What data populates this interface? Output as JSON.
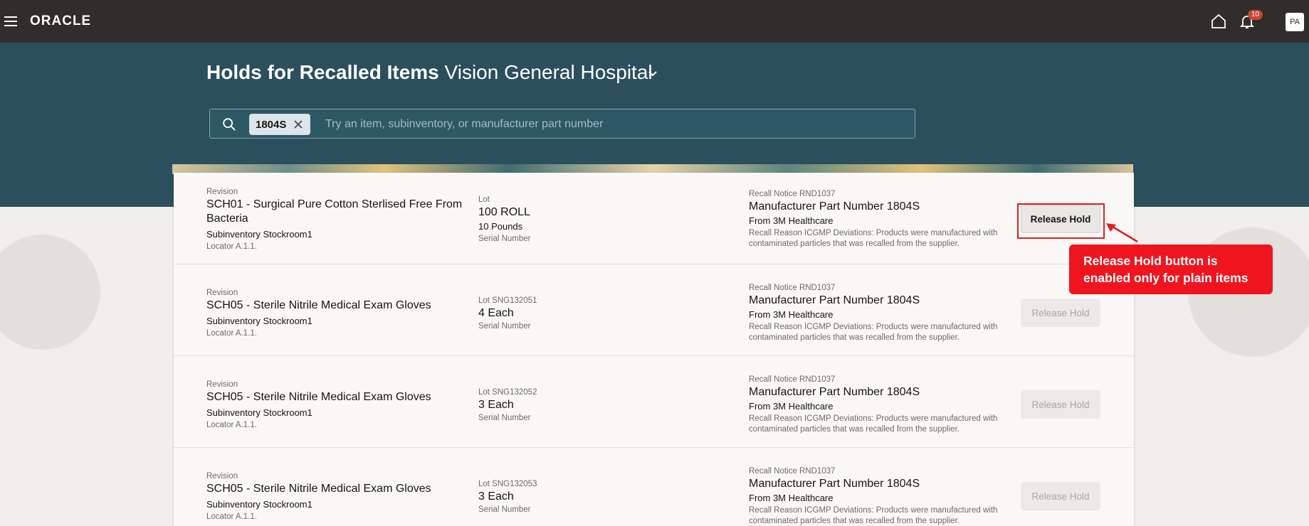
{
  "topbar": {
    "logo": "ORACLE",
    "notification_count": "10",
    "avatar_initials": "PA",
    "icons": [
      "menu-icon",
      "home-icon",
      "bell-icon"
    ]
  },
  "header": {
    "title_bold": "Holds for Recalled Items",
    "title_org": "Vision General Hospital"
  },
  "search": {
    "chip_value": "1804S",
    "placeholder": "Try an item, subinventory, or manufacturer part number"
  },
  "rows": [
    {
      "revision": "Revision",
      "item": "SCH01 - Surgical Pure Cotton Sterlised Free From Bacteria",
      "subinventory": "Subinventory Stockroom1",
      "locator": "Locator A.1.1.",
      "lot_label": "Lot",
      "quantity": "100 ROLL",
      "secondary_qty": "10 Pounds",
      "serial": "Serial Number",
      "recall_notice": "Recall Notice RND1037",
      "mpn": "Manufacturer Part Number 1804S",
      "from": "From 3M Healthcare",
      "reason_1": "Recall Reason ICGMP Deviations: Products were manufactured with",
      "reason_2": "contaminated particles that was recalled from the supplier.",
      "button": "Release Hold",
      "enabled": true
    },
    {
      "revision": "Revision",
      "item": "SCH05 - Sterile Nitrile Medical Exam Gloves",
      "subinventory": "Subinventory Stockroom1",
      "locator": "Locator A.1.1.",
      "lot_label": "Lot SNG132051",
      "quantity": "4 Each",
      "serial": "Serial Number",
      "recall_notice": "Recall Notice RND1037",
      "mpn": "Manufacturer Part Number 1804S",
      "from": "From 3M Healthcare",
      "reason_1": "Recall Reason ICGMP Deviations: Products were manufactured with",
      "reason_2": "contaminated particles that was recalled from the supplier.",
      "button": "Release Hold",
      "enabled": false
    },
    {
      "revision": "Revision",
      "item": "SCH05 - Sterile Nitrile Medical Exam Gloves",
      "subinventory": "Subinventory Stockroom1",
      "locator": "Locator A.1.1.",
      "lot_label": "Lot SNG132052",
      "quantity": "3 Each",
      "serial": "Serial Number",
      "recall_notice": "Recall Notice RND1037",
      "mpn": "Manufacturer Part Number 1804S",
      "from": "From 3M Healthcare",
      "reason_1": "Recall Reason ICGMP Deviations: Products were manufactured with",
      "reason_2": "contaminated particles that was recalled from the supplier.",
      "button": "Release Hold",
      "enabled": false
    },
    {
      "revision": "Revision",
      "item": "SCH05 - Sterile Nitrile Medical Exam Gloves",
      "subinventory": "Subinventory Stockroom1",
      "locator": "Locator A.1.1.",
      "lot_label": "Lot SNG132053",
      "quantity": "3 Each",
      "serial": "Serial Number",
      "recall_notice": "Recall Notice RND1037",
      "mpn": "Manufacturer Part Number 1804S",
      "from": "From 3M Healthcare",
      "reason_1": "Recall Reason ICGMP Deviations: Products were manufactured with",
      "reason_2": "contaminated particles that was recalled from the supplier.",
      "button": "Release Hold",
      "enabled": false
    }
  ],
  "callout": {
    "line1": "Release Hold button is",
    "line2": "enabled only for plain items",
    "color": "#f0141e"
  }
}
